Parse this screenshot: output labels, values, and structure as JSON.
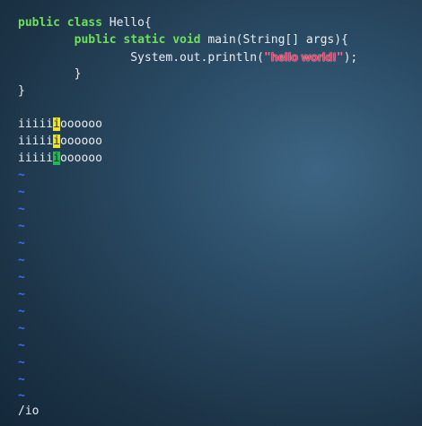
{
  "editor": {
    "code": {
      "line1": {
        "kw": "public class",
        "rest": " Hello{"
      },
      "line2": {
        "indent": "        ",
        "kw": "public static void",
        "rest": " main(String[] args){"
      },
      "line3": {
        "indent": "                ",
        "pre": "System.out.println(",
        "quote_open": "\"",
        "str": "hello world!",
        "quote_close": "\"",
        "post": ");"
      },
      "line4": {
        "text": "        }"
      },
      "line5": {
        "text": "}"
      }
    },
    "text_lines": [
      {
        "pre": "iiiii",
        "mid": "i",
        "post": "oooooo"
      },
      {
        "pre": "iiiii",
        "mid": "i",
        "post": "oooooo"
      },
      {
        "pre": "iiiii",
        "mid": "i",
        "post": "oooooo"
      }
    ],
    "empty_line_marker": "~",
    "command_line": "/io",
    "colors": {
      "keyword": "#6fe05a",
      "string": "#ff2a55",
      "search_highlight": "#e7e62e",
      "cursor": "#27b45a",
      "tilde": "#3d6df5"
    }
  }
}
